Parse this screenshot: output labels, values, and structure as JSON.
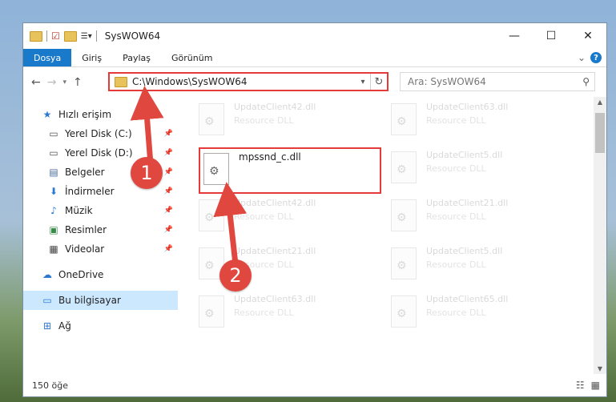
{
  "window": {
    "title": "SysWOW64",
    "controls": {
      "minimize": "—",
      "maximize": "☐",
      "close": "✕"
    }
  },
  "ribbon": {
    "tabs": [
      "Dosya",
      "Giriş",
      "Paylaş",
      "Görünüm"
    ],
    "expand": "⌄",
    "help": "?"
  },
  "address": {
    "path": "C:\\Windows\\SysWOW64",
    "search_placeholder": "Ara: SysWOW64"
  },
  "nav": {
    "items": [
      {
        "label": "Hızlı erişim",
        "icon": "star-icon",
        "pinned": false
      },
      {
        "label": "Yerel Disk (C:)",
        "icon": "drive-icon",
        "pinned": true
      },
      {
        "label": "Yerel Disk (D:)",
        "icon": "drive-icon",
        "pinned": true
      },
      {
        "label": "Belgeler",
        "icon": "document-icon",
        "pinned": true
      },
      {
        "label": "İndirmeler",
        "icon": "download-icon",
        "pinned": true
      },
      {
        "label": "Müzik",
        "icon": "music-icon",
        "pinned": true
      },
      {
        "label": "Resimler",
        "icon": "pictures-icon",
        "pinned": true
      },
      {
        "label": "Videolar",
        "icon": "video-icon",
        "pinned": true
      },
      {
        "label": "OneDrive",
        "icon": "cloud-icon",
        "pinned": false
      },
      {
        "label": "Bu bilgisayar",
        "icon": "computer-icon",
        "pinned": false,
        "selected": true
      },
      {
        "label": "Ağ",
        "icon": "network-icon",
        "pinned": false
      }
    ]
  },
  "files": {
    "highlighted": {
      "name": "mpssnd_c.dll"
    },
    "faded": [
      {
        "name": "UpdateClient42.dll",
        "desc": "Resource DLL"
      },
      {
        "name": "UpdateClient63.dll",
        "desc": "Resource DLL"
      },
      {
        "name": "UpdateClient5.dll",
        "desc": "Resource DLL"
      },
      {
        "name": "UpdateClient42.dll",
        "desc": "Resource DLL"
      },
      {
        "name": "UpdateClient21.dll",
        "desc": "Resource DLL"
      },
      {
        "name": "UpdateClient21.dll",
        "desc": "Resource DLL"
      },
      {
        "name": "UpdateClient5.dll",
        "desc": "Resource DLL"
      },
      {
        "name": "UpdateClient63.dll",
        "desc": "Resource DLL"
      },
      {
        "name": "UpdateClient65.dll",
        "desc": "Resource DLL"
      }
    ]
  },
  "status": {
    "count": "150 öğe"
  },
  "annotations": {
    "step1": "1",
    "step2": "2",
    "color": "#e0473e"
  }
}
